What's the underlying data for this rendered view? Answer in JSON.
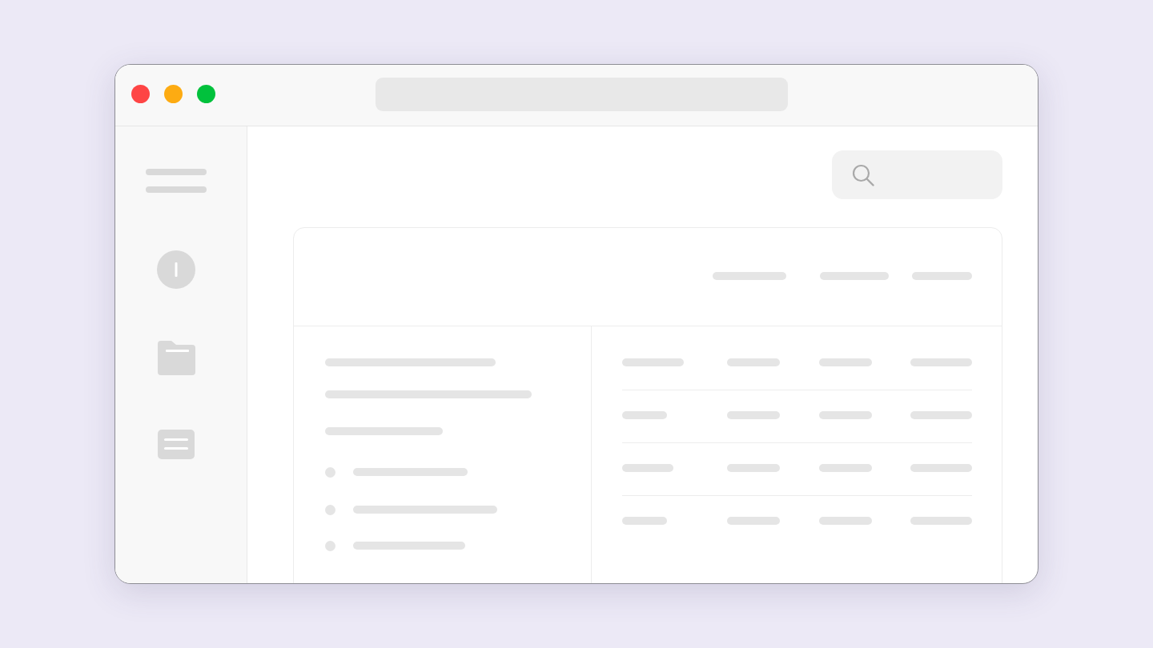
{
  "window": {
    "controls": [
      {
        "color": "#fe4545"
      },
      {
        "color": "#fdab12"
      },
      {
        "color": "#01c13c"
      }
    ]
  },
  "sidebar": {
    "items": [
      {
        "kind": "menu"
      },
      {
        "kind": "info"
      },
      {
        "kind": "folder"
      },
      {
        "kind": "list"
      }
    ]
  },
  "card": {
    "header": [
      {
        "kind": "skeleton"
      },
      {
        "kind": "skeleton"
      },
      {
        "kind": "skeleton"
      }
    ],
    "details": [
      {
        "kind": "line"
      },
      {
        "kind": "line"
      },
      {
        "kind": "line"
      },
      {
        "kind": "bullet"
      },
      {
        "kind": "bullet"
      },
      {
        "kind": "bullet"
      }
    ],
    "table": {
      "rows": [
        {
          "cells": [
            {
              "kind": "skeleton"
            },
            {
              "kind": "skeleton"
            },
            {
              "kind": "skeleton"
            },
            {
              "kind": "skeleton"
            }
          ]
        },
        {
          "cells": [
            {
              "kind": "skeleton"
            },
            {
              "kind": "skeleton"
            },
            {
              "kind": "skeleton"
            },
            {
              "kind": "skeleton"
            }
          ]
        },
        {
          "cells": [
            {
              "kind": "skeleton"
            },
            {
              "kind": "skeleton"
            },
            {
              "kind": "skeleton"
            },
            {
              "kind": "skeleton"
            }
          ]
        },
        {
          "cells": [
            {
              "kind": "skeleton"
            },
            {
              "kind": "skeleton"
            },
            {
              "kind": "skeleton"
            },
            {
              "kind": "skeleton"
            }
          ]
        }
      ]
    }
  }
}
